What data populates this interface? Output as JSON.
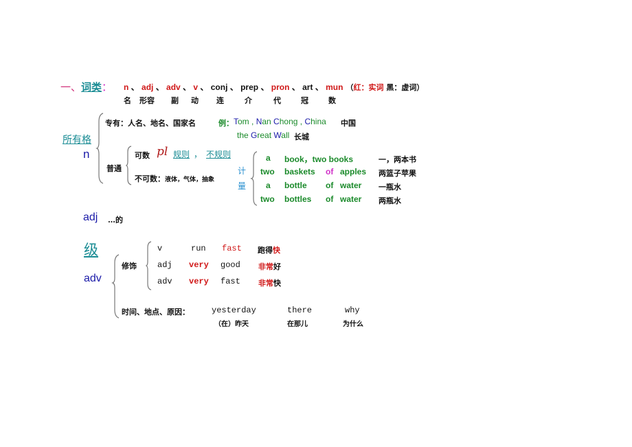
{
  "header": {
    "number": "一、",
    "title": "词类",
    "colon": "：",
    "parts": [
      {
        "en": "n",
        "zh": "名",
        "color": "red"
      },
      {
        "en": "adj",
        "zh": "形容",
        "color": "red"
      },
      {
        "en": "adv",
        "zh": "副",
        "color": "red"
      },
      {
        "en": "v",
        "zh": "动",
        "color": "red"
      },
      {
        "en": "conj",
        "zh": "连",
        "color": "black"
      },
      {
        "en": "prep",
        "zh": "介",
        "color": "black"
      },
      {
        "en": "pron",
        "zh": "代",
        "color": "red"
      },
      {
        "en": "art",
        "zh": "冠",
        "color": "black"
      },
      {
        "en": "mun",
        "zh": "数",
        "color": "red"
      }
    ],
    "sep": "、",
    "legend_open": "（",
    "legend_red": "红：实词",
    "legend_black": "黑：虚词",
    "legend_close": "）"
  },
  "noun": {
    "possessive": "所有格",
    "label": "n",
    "proper": {
      "label": "专有：人名、地名、国家名",
      "example_label": "例：",
      "line1": [
        {
          "cap": "T",
          "rest": "om"
        },
        {
          "sep": " , "
        },
        {
          "cap": "N",
          "rest": "an "
        },
        {
          "cap": "C",
          "rest": "hong"
        },
        {
          "sep": " , "
        },
        {
          "cap": "C",
          "rest": "hina"
        }
      ],
      "line1_zh": "中国",
      "line2": [
        {
          "cap": "",
          "rest": "the  "
        },
        {
          "cap": "G",
          "rest": "reat  "
        },
        {
          "cap": "W",
          "rest": "all"
        }
      ],
      "line2_zh": "长城"
    },
    "common": {
      "label": "普通",
      "countable_label": "可数",
      "pl": "pl",
      "regular": "规则",
      "comma": "，",
      "irregular": "不规则",
      "uncountable_label": "不可数：",
      "uncountable_types": "液体，气体，抽象"
    },
    "measure": {
      "label_1": "计",
      "label_2": "量",
      "rows": [
        {
          "c1": "a",
          "c2": "book，two  books",
          "of": "",
          "c3": "",
          "zh": "一，两本书"
        },
        {
          "c1": "two",
          "c2": "baskets",
          "of": "of",
          "c3": "apples",
          "zh": "两篮子苹果"
        },
        {
          "c1": "a",
          "c2": "bottle",
          "of": "of",
          "c3": "water",
          "zh": "一瓶水"
        },
        {
          "c1": "two",
          "c2": "bottles",
          "of": "of",
          "c3": "water",
          "zh": "两瓶水"
        }
      ]
    }
  },
  "adj": {
    "label": "adj",
    "meaning": "…的"
  },
  "grade": {
    "label": "级"
  },
  "adv": {
    "label": "adv",
    "modify_label": "修饰",
    "modify_rows": [
      {
        "a": "v",
        "b": "run",
        "b_red": false,
        "c": "fast",
        "c_red": true,
        "zh_black": "跑得",
        "zh_red": "快",
        "zh_tail": ""
      },
      {
        "a": "adj",
        "b": "very",
        "b_red": true,
        "c": "good",
        "c_red": false,
        "zh_black": "",
        "zh_red": "非常",
        "zh_tail": "好"
      },
      {
        "a": "adv",
        "b": "very",
        "b_red": true,
        "c": "fast",
        "c_red": false,
        "zh_black": "",
        "zh_red": "非常",
        "zh_tail": "快"
      }
    ],
    "tpr_label": "时间、地点、原因：",
    "tpr_words": [
      {
        "en": "yesterday",
        "zh": "（在）昨天"
      },
      {
        "en": "there",
        "zh": "在那儿"
      },
      {
        "en": "why",
        "zh": "为什么"
      }
    ]
  }
}
